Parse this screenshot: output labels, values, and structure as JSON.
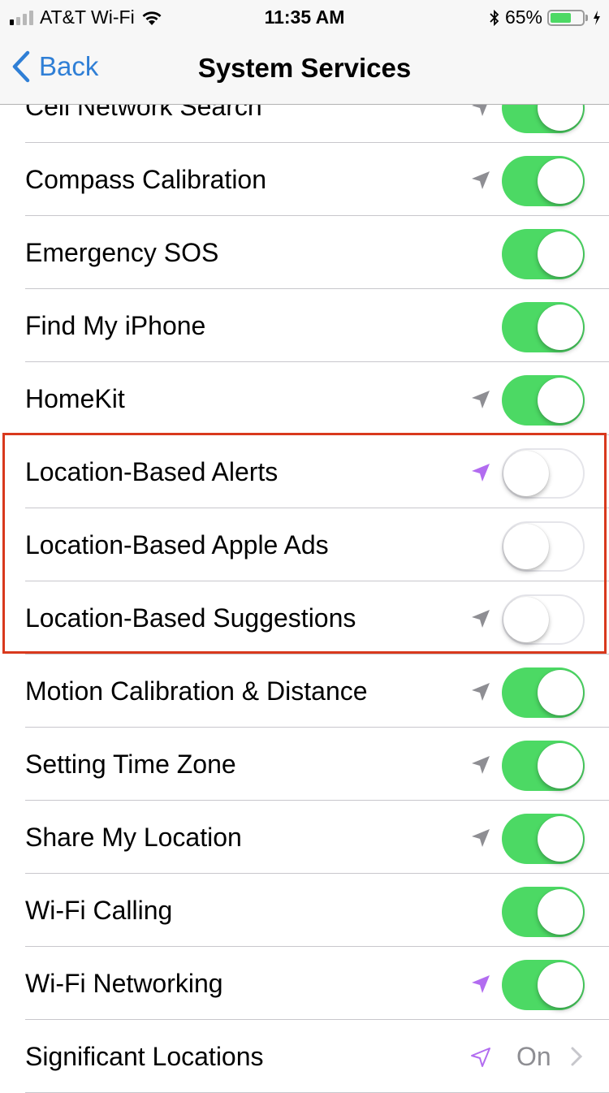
{
  "status_bar": {
    "carrier": "AT&T Wi-Fi",
    "time": "11:35 AM",
    "battery_percent": "65%",
    "battery_level": 0.65,
    "signal_bars_active": 1,
    "signal_bars_total": 4
  },
  "nav": {
    "back_label": "Back",
    "title": "System Services"
  },
  "colors": {
    "accent": "#2f7fd6",
    "toggle_on": "#4cd964",
    "location_recent": "#b26cf0",
    "location_used": "#8e8e93",
    "highlight_box": "#d9391d"
  },
  "services": [
    {
      "label": "Cell Network Search",
      "location_icon": "gray",
      "toggle": "on"
    },
    {
      "label": "Compass Calibration",
      "location_icon": "gray",
      "toggle": "on"
    },
    {
      "label": "Emergency SOS",
      "location_icon": "none",
      "toggle": "on"
    },
    {
      "label": "Find My iPhone",
      "location_icon": "none",
      "toggle": "on"
    },
    {
      "label": "HomeKit",
      "location_icon": "gray",
      "toggle": "on"
    },
    {
      "label": "Location-Based Alerts",
      "location_icon": "purple",
      "toggle": "off"
    },
    {
      "label": "Location-Based Apple Ads",
      "location_icon": "none",
      "toggle": "off"
    },
    {
      "label": "Location-Based Suggestions",
      "location_icon": "gray",
      "toggle": "off"
    },
    {
      "label": "Motion Calibration & Distance",
      "location_icon": "gray",
      "toggle": "on"
    },
    {
      "label": "Setting Time Zone",
      "location_icon": "gray",
      "toggle": "on"
    },
    {
      "label": "Share My Location",
      "location_icon": "gray",
      "toggle": "on"
    },
    {
      "label": "Wi-Fi Calling",
      "location_icon": "none",
      "toggle": "on"
    },
    {
      "label": "Wi-Fi Networking",
      "location_icon": "purple",
      "toggle": "on"
    },
    {
      "label": "Significant Locations",
      "location_icon": "purple-outline",
      "value": "On",
      "disclosure": true
    }
  ]
}
